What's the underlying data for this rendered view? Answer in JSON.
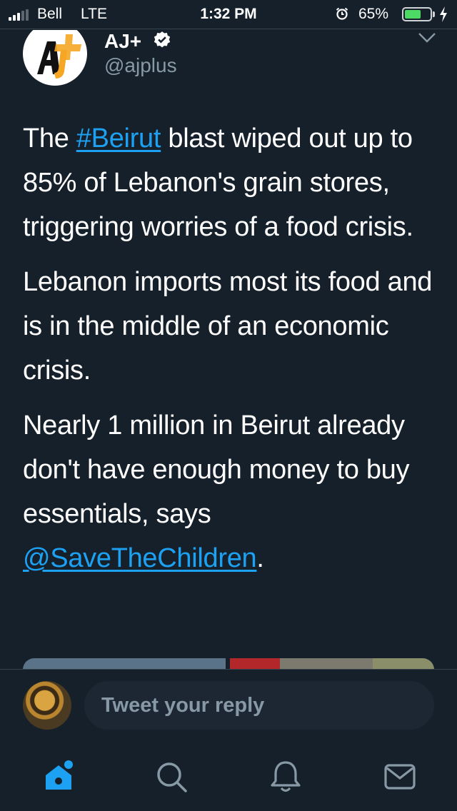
{
  "status_bar": {
    "carrier": "Bell",
    "network": "LTE",
    "time": "1:32 PM",
    "battery_percent": "65%",
    "battery_level": 0.65,
    "icons": [
      "signal-icon",
      "alarm-icon",
      "battery-icon",
      "charging-icon"
    ]
  },
  "tweet": {
    "author": {
      "display_name": "AJ+",
      "handle": "@ajplus",
      "avatar_text": "AJ+",
      "verified": true
    },
    "paragraph1": {
      "pre": "The ",
      "hashtag": "#Beirut",
      "post": " blast wiped out up to 85% of Lebanon's grain stores, triggering worries of a food crisis."
    },
    "paragraph2": "Lebanon imports most its food and is in the middle of an economic crisis.",
    "paragraph3": {
      "pre": "Nearly 1 million in Beirut already don't have enough money to buy essentials, says ",
      "mention": "@SaveTheChildren",
      "post": "."
    }
  },
  "reply": {
    "placeholder": "Tweet your reply"
  },
  "tab_bar": {
    "items": [
      "home-icon",
      "search-icon",
      "notifications-icon",
      "messages-icon"
    ]
  },
  "colors": {
    "background": "#15202b",
    "link": "#1da1f2",
    "secondary_text": "#8899a6",
    "divider": "#38444d",
    "battery": "#4cd964"
  }
}
